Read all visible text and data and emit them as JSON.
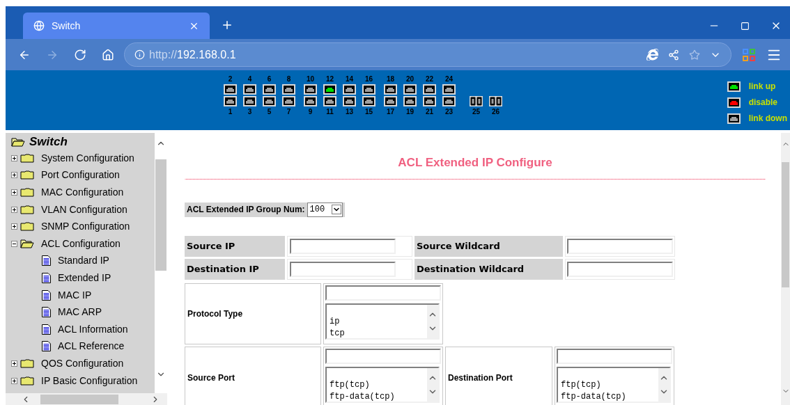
{
  "browser": {
    "tab": {
      "title": "Switch",
      "selected": true
    },
    "address": {
      "scheme": "http://",
      "host": "192.168.0.1"
    }
  },
  "ports": {
    "groups": [
      {
        "top": [
          {
            "label": "2",
            "color": "#a0a0a0"
          },
          {
            "label": "4",
            "color": "#a0a0a0"
          },
          {
            "label": "6",
            "color": "#a0a0a0"
          },
          {
            "label": "8",
            "color": "#a0a0a0"
          }
        ],
        "bottom": [
          {
            "label": "1",
            "color": "#a0a0a0"
          },
          {
            "label": "3",
            "color": "#a0a0a0"
          },
          {
            "label": "5",
            "color": "#a0a0a0"
          },
          {
            "label": "7",
            "color": "#a0a0a0"
          }
        ]
      },
      {
        "top": [
          {
            "label": "10",
            "color": "#a0a0a0"
          },
          {
            "label": "12",
            "color": "#00e000"
          },
          {
            "label": "14",
            "color": "#a0a0a0"
          },
          {
            "label": "16",
            "color": "#a0a0a0"
          }
        ],
        "bottom": [
          {
            "label": "9",
            "color": "#a0a0a0"
          },
          {
            "label": "11",
            "color": "#a0a0a0"
          },
          {
            "label": "13",
            "color": "#a0a0a0"
          },
          {
            "label": "15",
            "color": "#a0a0a0"
          }
        ]
      },
      {
        "top": [
          {
            "label": "18",
            "color": "#a0a0a0"
          },
          {
            "label": "20",
            "color": "#a0a0a0"
          },
          {
            "label": "22",
            "color": "#a0a0a0"
          },
          {
            "label": "24",
            "color": "#a0a0a0"
          }
        ],
        "bottom": [
          {
            "label": "17",
            "color": "#a0a0a0"
          },
          {
            "label": "19",
            "color": "#a0a0a0"
          },
          {
            "label": "21",
            "color": "#a0a0a0"
          },
          {
            "label": "23",
            "color": "#a0a0a0"
          }
        ]
      }
    ],
    "fiber": [
      {
        "label": "25",
        "color": "#a0a0a0"
      },
      {
        "label": "26",
        "color": "#a0a0a0"
      }
    ]
  },
  "legend": [
    {
      "color": "#00e000",
      "label": "link up"
    },
    {
      "color": "#ff0000",
      "label": "disable"
    },
    {
      "color": "#a0a0a0",
      "label": "link down"
    }
  ],
  "sidebar": {
    "root": "Switch",
    "items": [
      {
        "label": "System Configuration",
        "expanded": false
      },
      {
        "label": "Port Configuration",
        "expanded": false
      },
      {
        "label": "MAC Configuration",
        "expanded": false
      },
      {
        "label": "VLAN Configuration",
        "expanded": false
      },
      {
        "label": "SNMP Configuration",
        "expanded": false
      },
      {
        "label": "ACL Configuration",
        "expanded": true,
        "children": [
          {
            "label": "Standard IP"
          },
          {
            "label": "Extended IP"
          },
          {
            "label": "MAC IP"
          },
          {
            "label": "MAC ARP"
          },
          {
            "label": "ACL Information"
          },
          {
            "label": "ACL Reference"
          }
        ]
      },
      {
        "label": "QOS Configuration",
        "expanded": false
      },
      {
        "label": "IP Basic Configuration",
        "expanded": false
      }
    ]
  },
  "page": {
    "title": "ACL Extended IP Configure",
    "group_num": {
      "label": "ACL Extended IP Group Num:",
      "value": "100"
    },
    "ip_rows": [
      {
        "left": "Source IP",
        "right": "Source Wildcard"
      },
      {
        "left": "Destination IP",
        "right": "Destination Wildcard"
      }
    ],
    "protocol": {
      "label": "Protocol Type",
      "options": [
        "ip",
        "tcp"
      ]
    },
    "ports": [
      {
        "label": "Source Port",
        "options": [
          "ftp(tcp)",
          "ftp-data(tcp)"
        ]
      },
      {
        "label": "Destination Port",
        "options": [
          "ftp(tcp)",
          "ftp-data(tcp)"
        ]
      }
    ]
  }
}
